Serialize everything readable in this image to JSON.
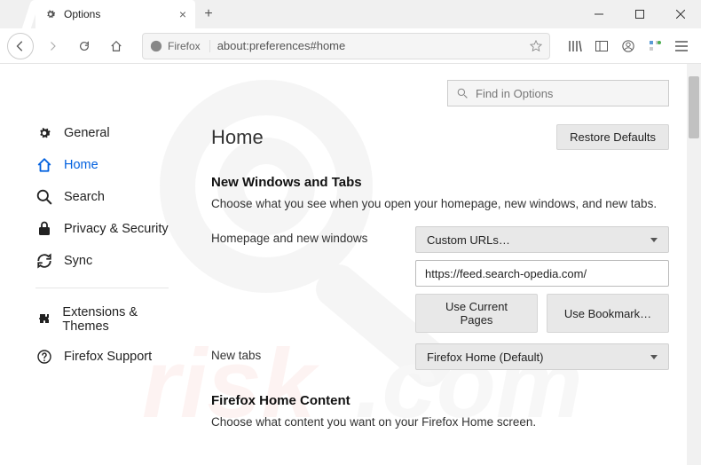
{
  "window": {
    "tab_title": "Options",
    "url_brand": "Firefox",
    "url": "about:preferences#home"
  },
  "find": {
    "placeholder": "Find in Options"
  },
  "sidebar": {
    "items": [
      {
        "label": "General"
      },
      {
        "label": "Home"
      },
      {
        "label": "Search"
      },
      {
        "label": "Privacy & Security"
      },
      {
        "label": "Sync"
      }
    ],
    "bottom": [
      {
        "label": "Extensions & Themes"
      },
      {
        "label": "Firefox Support"
      }
    ]
  },
  "main": {
    "title": "Home",
    "restore": "Restore Defaults",
    "section1": {
      "heading": "New Windows and Tabs",
      "desc": "Choose what you see when you open your homepage, new windows, and new tabs.",
      "homepage_label": "Homepage and new windows",
      "homepage_select": "Custom URLs…",
      "homepage_value": "https://feed.search-opedia.com/",
      "use_current": "Use Current Pages",
      "use_bookmark": "Use Bookmark…",
      "newtabs_label": "New tabs",
      "newtabs_select": "Firefox Home (Default)"
    },
    "section2": {
      "heading": "Firefox Home Content",
      "desc": "Choose what content you want on your Firefox Home screen."
    }
  }
}
